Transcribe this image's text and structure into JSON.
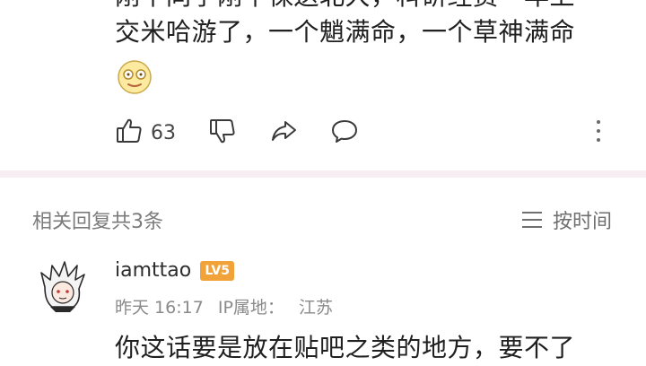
{
  "post": {
    "line1_partial": "刚午同学刚午保送北大，科研经费一年上",
    "line2": "交米哈游了，一个魈满命，一个草神满命"
  },
  "actions": {
    "like_count": "63"
  },
  "replies": {
    "title": "相关回复共3条",
    "sort_label": "按时间"
  },
  "reply": {
    "username": "iamttao",
    "level_badge": "LV5",
    "time": "昨天 16:17",
    "ip_label": "IP属地：",
    "ip_location": "江苏",
    "text": "你这话要是放在贴吧之类的地方，要不了"
  },
  "colors": {
    "divider": "#f7eef3",
    "level_badge": "#f1a33a"
  },
  "icons": [
    "smiling-emoji-icon",
    "thumbs-up-icon",
    "thumbs-down-icon",
    "share-icon",
    "comment-icon",
    "more-icon",
    "sort-icon"
  ]
}
